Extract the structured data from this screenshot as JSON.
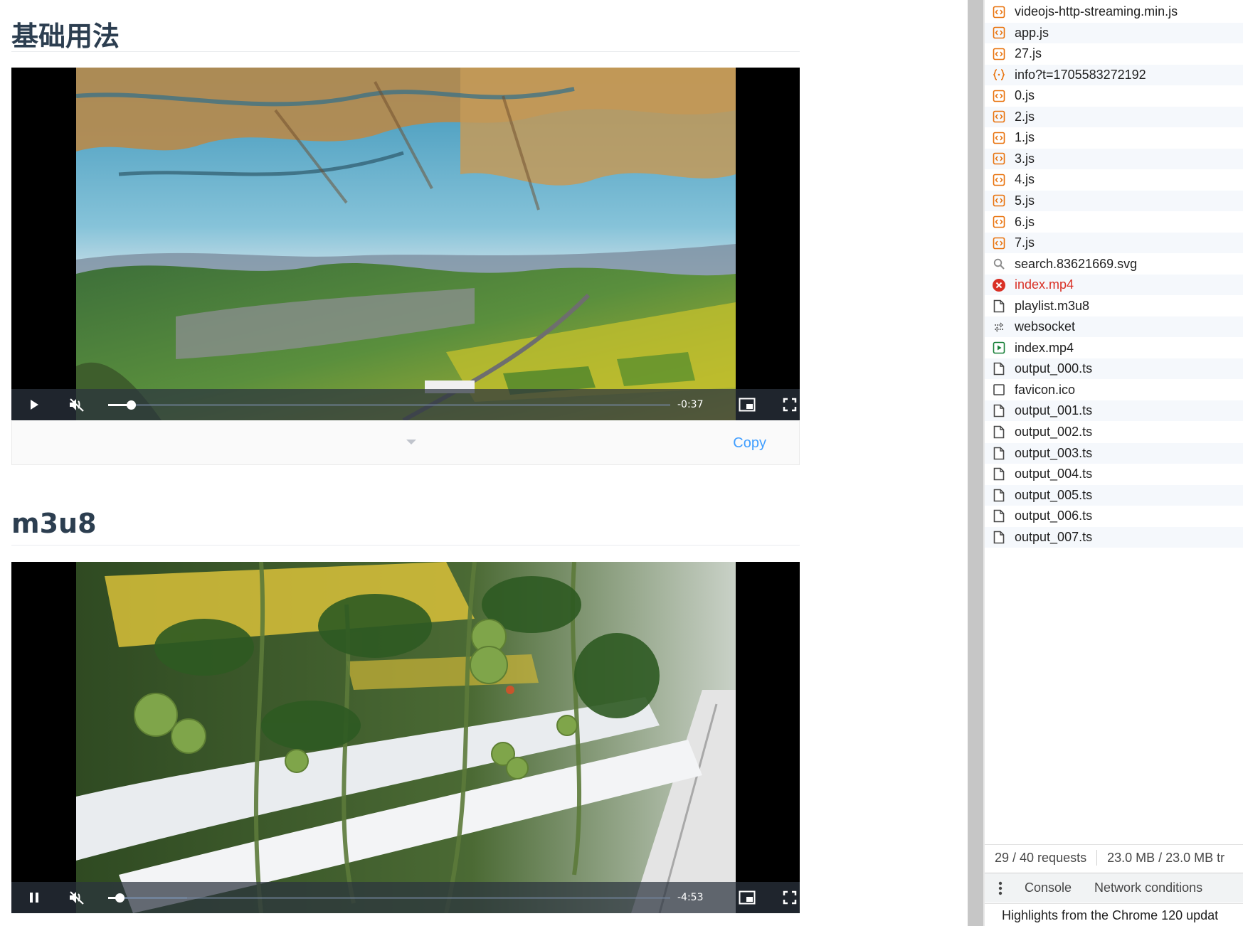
{
  "doc": {
    "section1_title": "基础用法",
    "section2_title": "m3u8",
    "copy_label": "Copy",
    "player1": {
      "time_remaining": "-0:37",
      "progress": 0.04,
      "buffered": 0.04,
      "state": "paused"
    },
    "player2": {
      "time_remaining": "-4:53",
      "progress": 0.02,
      "buffered": 0.14,
      "state": "playing"
    }
  },
  "devtools": {
    "requests": [
      {
        "name": "videojs-http-streaming.min.js",
        "icon": "script-icon",
        "error": false
      },
      {
        "name": "app.js",
        "icon": "script-icon",
        "error": false
      },
      {
        "name": "27.js",
        "icon": "script-icon",
        "error": false
      },
      {
        "name": "info?t=1705583272192",
        "icon": "json-icon",
        "error": false
      },
      {
        "name": "0.js",
        "icon": "script-icon",
        "error": false
      },
      {
        "name": "2.js",
        "icon": "script-icon",
        "error": false
      },
      {
        "name": "1.js",
        "icon": "script-icon",
        "error": false
      },
      {
        "name": "3.js",
        "icon": "script-icon",
        "error": false
      },
      {
        "name": "4.js",
        "icon": "script-icon",
        "error": false
      },
      {
        "name": "5.js",
        "icon": "script-icon",
        "error": false
      },
      {
        "name": "6.js",
        "icon": "script-icon",
        "error": false
      },
      {
        "name": "7.js",
        "icon": "script-icon",
        "error": false
      },
      {
        "name": "search.83621669.svg",
        "icon": "search-icon",
        "error": false
      },
      {
        "name": "index.mp4",
        "icon": "error-icon",
        "error": true
      },
      {
        "name": "playlist.m3u8",
        "icon": "document-icon",
        "error": false
      },
      {
        "name": "websocket",
        "icon": "websocket-icon",
        "error": false
      },
      {
        "name": "index.mp4",
        "icon": "media-icon",
        "error": false
      },
      {
        "name": "output_000.ts",
        "icon": "document-icon",
        "error": false
      },
      {
        "name": "favicon.ico",
        "icon": "image-icon",
        "error": false
      },
      {
        "name": "output_001.ts",
        "icon": "document-icon",
        "error": false
      },
      {
        "name": "output_002.ts",
        "icon": "document-icon",
        "error": false
      },
      {
        "name": "output_003.ts",
        "icon": "document-icon",
        "error": false
      },
      {
        "name": "output_004.ts",
        "icon": "document-icon",
        "error": false
      },
      {
        "name": "output_005.ts",
        "icon": "document-icon",
        "error": false
      },
      {
        "name": "output_006.ts",
        "icon": "document-icon",
        "error": false
      },
      {
        "name": "output_007.ts",
        "icon": "document-icon",
        "error": false
      }
    ],
    "status": {
      "requests": "29 / 40 requests",
      "transferred": "23.0 MB / 23.0 MB tr"
    },
    "drawer_tabs": [
      "Console",
      "Network conditions"
    ],
    "news": "Highlights from the Chrome 120 updat"
  },
  "colors": {
    "script": "#e8710a",
    "error": "#d93025",
    "media": "#188038",
    "link": "#409eff"
  }
}
